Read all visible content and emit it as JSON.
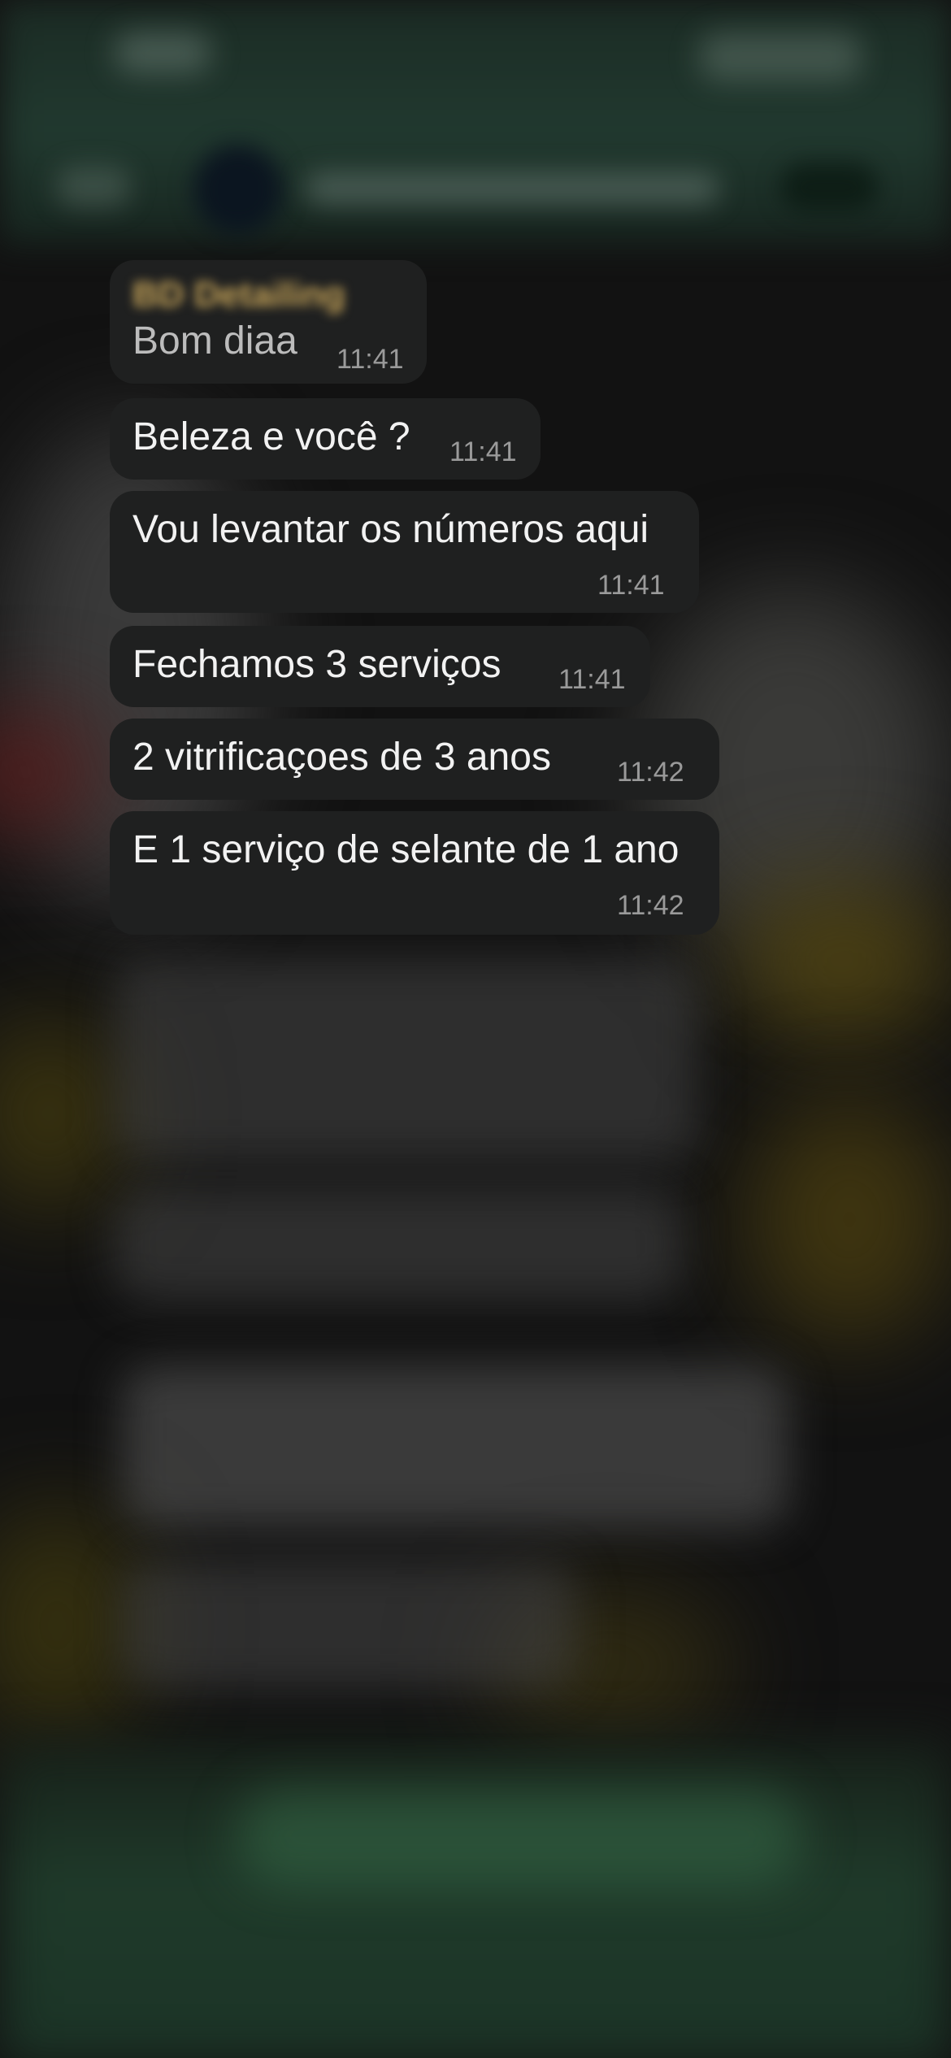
{
  "chat": {
    "sender_name": "BD Detailing",
    "messages": [
      {
        "text": "Bom diaa",
        "time": "11:41"
      },
      {
        "text": "Beleza e você ?",
        "time": "11:41"
      },
      {
        "text": "Vou levantar os números aqui",
        "time": "11:41"
      },
      {
        "text": "Fechamos 3 serviços",
        "time": "11:41"
      },
      {
        "text": "2 vitrificaçoes de 3 anos",
        "time": "11:42"
      },
      {
        "text": "E 1 serviço de selante de 1 ano",
        "time": "11:42"
      }
    ]
  },
  "colors": {
    "bubble": "#1f2020",
    "text": "#f2f2f2",
    "timestamp": "#9a9a9a",
    "sender": "#c9a65a",
    "header_green": "#21392f"
  }
}
